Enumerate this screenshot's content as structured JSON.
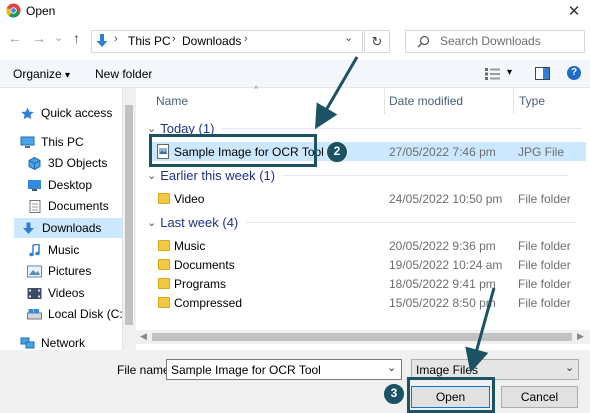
{
  "window": {
    "title": "Open",
    "close_glyph": "✕"
  },
  "address": {
    "back_glyph": "←",
    "forward_glyph": "→",
    "recent_glyph": "⌄",
    "up_glyph": "↑",
    "crumbs": [
      "This PC",
      "Downloads"
    ],
    "chevron_glyph": "›",
    "dropdown_glyph": "⌄",
    "refresh_glyph": "↻",
    "search_placeholder": "Search Downloads"
  },
  "toolbar": {
    "organize": "Organize",
    "organize_caret": "▾",
    "new_folder": "New folder",
    "view_caret": "▾",
    "help": "?"
  },
  "nav": {
    "items": [
      {
        "label": "Quick access",
        "icon": "star-icon"
      },
      {
        "label": "This PC",
        "icon": "computer-icon"
      },
      {
        "label": "3D Objects",
        "icon": "cube-icon"
      },
      {
        "label": "Desktop",
        "icon": "desktop-icon"
      },
      {
        "label": "Documents",
        "icon": "documents-icon"
      },
      {
        "label": "Downloads",
        "icon": "download-icon"
      },
      {
        "label": "Music",
        "icon": "music-icon"
      },
      {
        "label": "Pictures",
        "icon": "pictures-icon"
      },
      {
        "label": "Videos",
        "icon": "videos-icon"
      },
      {
        "label": "Local Disk (C:)",
        "icon": "disk-icon"
      },
      {
        "label": "Network",
        "icon": "network-icon"
      }
    ],
    "selected": "Downloads"
  },
  "columns": {
    "name": "Name",
    "date": "Date modified",
    "type": "Type",
    "sort_glyph": "^"
  },
  "groups": [
    {
      "label": "Today (1)",
      "chevron": "⌄"
    },
    {
      "label": "Earlier this week (1)",
      "chevron": "⌄"
    },
    {
      "label": "Last week (4)",
      "chevron": "⌄"
    }
  ],
  "files": [
    {
      "name": "Sample Image for OCR Tool",
      "date": "27/05/2022 7:46 pm",
      "type": "JPG File"
    },
    {
      "name": "Video",
      "date": "24/05/2022 10:50 pm",
      "type": "File folder"
    },
    {
      "name": "Music",
      "date": "20/05/2022 9:36 pm",
      "type": "File folder"
    },
    {
      "name": "Documents",
      "date": "19/05/2022 10:24 am",
      "type": "File folder"
    },
    {
      "name": "Programs",
      "date": "18/05/2022 9:41 pm",
      "type": "File folder"
    },
    {
      "name": "Compressed",
      "date": "15/05/2022 8:50 pm",
      "type": "File folder"
    }
  ],
  "bottom": {
    "file_name_label": "File name:",
    "file_name_value": "Sample Image for OCR Tool",
    "file_type": "Image Files",
    "caret": "⌄",
    "open": "Open",
    "cancel": "Cancel"
  },
  "annotations": {
    "step2": "2",
    "step3": "3",
    "color": "#1b5264"
  }
}
